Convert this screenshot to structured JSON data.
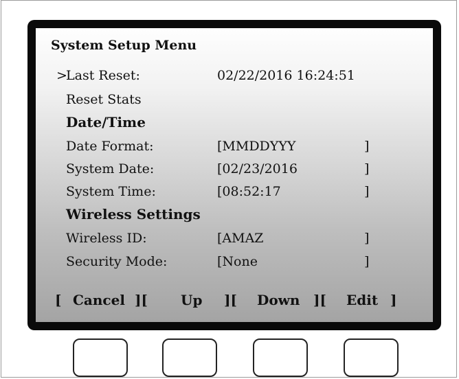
{
  "screen": {
    "title": "System Setup Menu",
    "cursor": ">",
    "rows": [
      {
        "label": "Last Reset:",
        "value": "02/22/2016  16:24:51",
        "close": ""
      },
      {
        "label": "Reset Stats",
        "value": "",
        "close": ""
      },
      {
        "label": "Date/Time",
        "section": true
      },
      {
        "label": "Date Format:",
        "value": "[MMDDYYY",
        "close": "]"
      },
      {
        "label": "System Date:",
        "value": "[02/23/2016",
        "close": "]"
      },
      {
        "label": "System Time:",
        "value": "[08:52:17",
        "close": "]"
      },
      {
        "label": "Wireless Settings",
        "section": true
      },
      {
        "label": "Wireless ID:",
        "value": "[AMAZ",
        "close": "]"
      },
      {
        "label": "Security Mode:",
        "value": "[None",
        "close": "]"
      }
    ]
  },
  "softkeys": {
    "open": "[",
    "sep": "][",
    "close": "]",
    "cancel": "Cancel",
    "up": "Up",
    "down": "Down",
    "edit": "Edit"
  }
}
